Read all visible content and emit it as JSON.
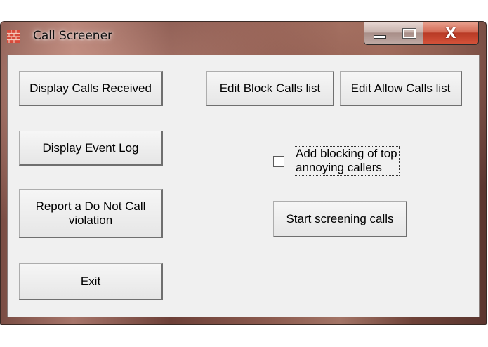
{
  "window": {
    "title": "Call Screener",
    "close_glyph": "X"
  },
  "buttons": {
    "display_calls_received": "Display Calls Received",
    "edit_block_calls": "Edit Block Calls list",
    "edit_allow_calls": "Edit Allow Calls list",
    "display_event_log": "Display Event Log",
    "report_dnc_line1": "Report a Do Not Call",
    "report_dnc_line2": "violation",
    "start_screening": "Start screening calls",
    "exit": "Exit"
  },
  "checkbox": {
    "label_line1": "Add blocking of top",
    "label_line2": "annoying callers",
    "checked": false
  },
  "icons": {
    "app": "brick-wall-icon",
    "minimize": "minimize-icon",
    "maximize": "maximize-icon",
    "close": "close-icon"
  },
  "colors": {
    "client_bg": "#f0f0f0",
    "close_button": "#c7442c",
    "app_icon": "#d84a3a"
  }
}
